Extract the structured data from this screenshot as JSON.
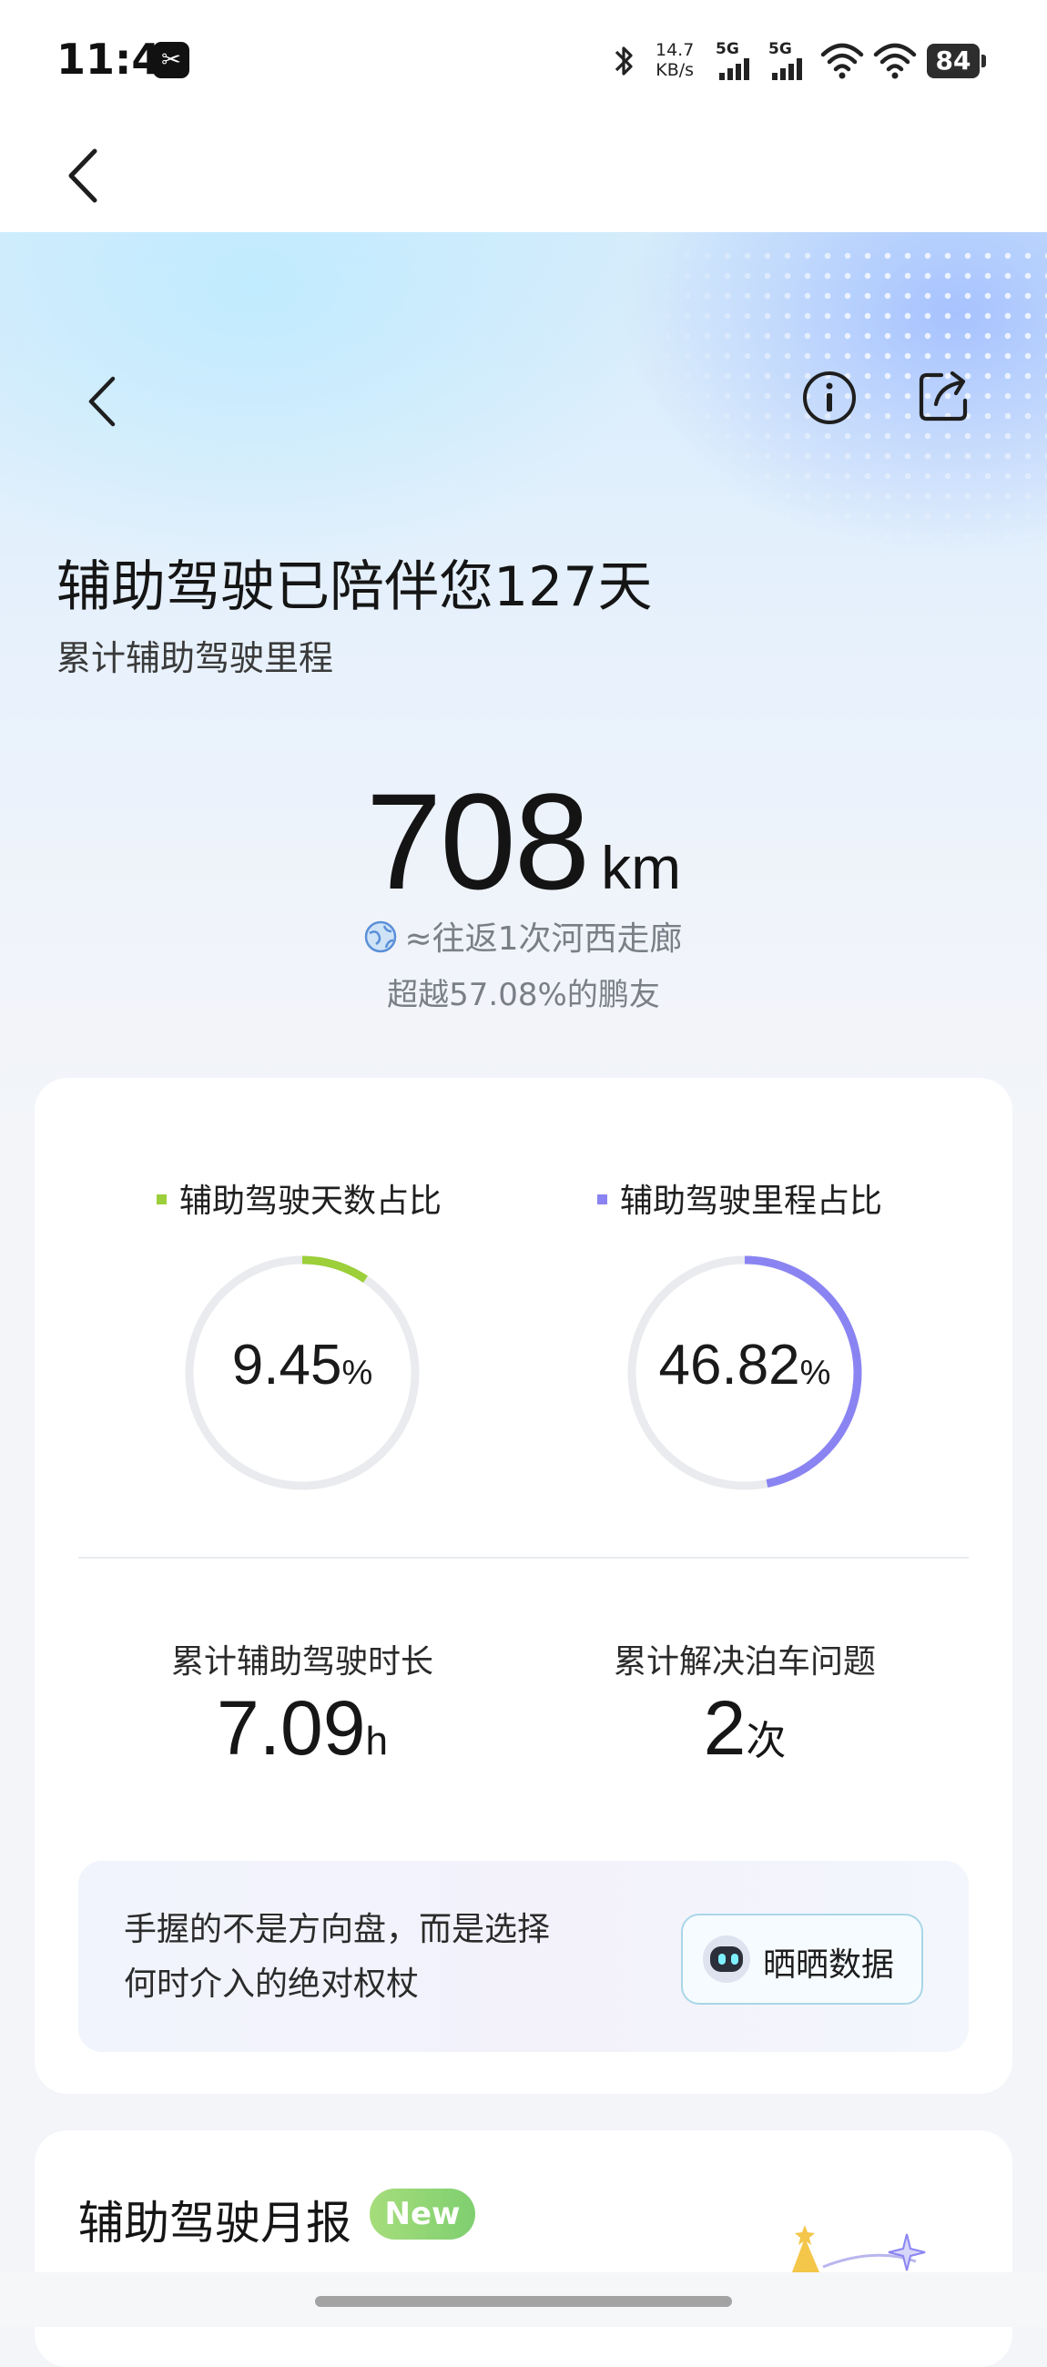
{
  "status_bar": {
    "time": "11:41",
    "app_icon": "capcut-icon",
    "net_speed_value": "14.7",
    "net_speed_unit": "KB/s",
    "sim1": "5G",
    "sim2": "5G",
    "battery": "84"
  },
  "nav": {
    "back_icon": "chevron-left-icon"
  },
  "hero": {
    "title": "辅助驾驶已陪伴您127天",
    "subtitle": "累计辅助驾驶里程",
    "mileage_value": "708",
    "mileage_unit": "km",
    "equivalence": "≈往返1次河西走廊",
    "rank": "超越57.08%的鹏友",
    "icons": [
      "chevron-left-icon",
      "info-icon",
      "share-icon",
      "globe-icon"
    ]
  },
  "stats": {
    "days_ratio": {
      "label": "辅助驾驶天数占比",
      "value": "9.45",
      "unit": "%",
      "fraction": 0.0945,
      "color": "#9ccf3a"
    },
    "mileage_ratio": {
      "label": "辅助驾驶里程占比",
      "value": "46.82",
      "unit": "%",
      "fraction": 0.4682,
      "color": "#8a84f2"
    },
    "duration": {
      "label": "累计辅助驾驶时长",
      "value": "7.09",
      "unit": "h"
    },
    "parking": {
      "label": "累计解决泊车问题",
      "value": "2",
      "unit": "次"
    },
    "ring_track_color": "#e9ebee"
  },
  "quote": {
    "line1": "手握的不是方向盘，而是选择",
    "line2": "何时介入的绝对权杖",
    "share_button": "晒晒数据"
  },
  "monthly": {
    "title": "辅助驾驶月报",
    "badge": "New"
  }
}
